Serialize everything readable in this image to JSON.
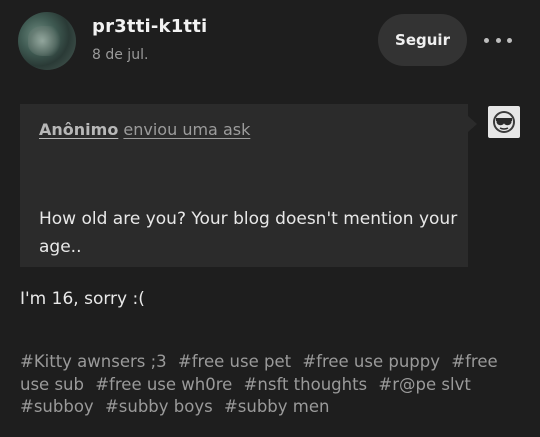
{
  "post": {
    "username": "pr3tti-k1tti",
    "date": "8 de jul.",
    "follow_label": "Seguir"
  },
  "ask": {
    "asker": "Anônimo",
    "sent_text": "enviou uma ask",
    "question": "How old are you? Your blog doesn't mention your age.."
  },
  "answer": "I'm 16, sorry :(",
  "tags": [
    "#Kitty awnsers ;3",
    "#free use pet",
    "#free use puppy",
    "#free use sub",
    "#free use wh0re",
    "#nsft thoughts",
    "#r@pe slvt",
    "#subboy",
    "#subby boys",
    "#subby men"
  ]
}
